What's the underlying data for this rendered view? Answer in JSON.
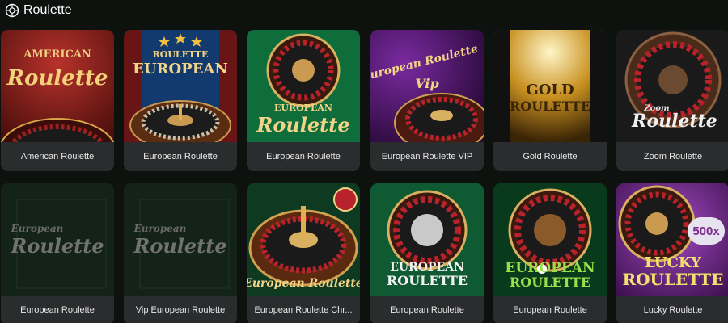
{
  "header": {
    "title": "Roulette",
    "icon": "roulette-icon"
  },
  "games": [
    {
      "label": "American Roulette",
      "art_lines": [
        "AMERICAN",
        "Roulette"
      ]
    },
    {
      "label": "European Roulette",
      "art_lines": [
        "ROULETTE",
        "EUROPEAN"
      ]
    },
    {
      "label": "European Roulette",
      "art_lines": [
        "EUROPEAN",
        "Roulette"
      ]
    },
    {
      "label": "European Roulette VIP",
      "art_lines": [
        "European Roulette",
        "Vip"
      ]
    },
    {
      "label": "Gold Roulette",
      "art_lines": [
        "GOLD",
        "ROULETTE"
      ]
    },
    {
      "label": "Zoom Roulette",
      "art_lines": [
        "Zoom",
        "Roulette"
      ]
    },
    {
      "label": "European Roulette",
      "art_lines": [
        "European",
        "Roulette"
      ]
    },
    {
      "label": "Vip European Roulette",
      "art_lines": [
        "European",
        "Roulette"
      ]
    },
    {
      "label": "European Roulette Chr...",
      "art_lines": [
        "European Roulette"
      ]
    },
    {
      "label": "European Roulette",
      "art_lines": [
        "EUROPEAN",
        "ROULETTE"
      ]
    },
    {
      "label": "European Roulette",
      "art_lines": [
        "EUROPEAN",
        "ROULETTE"
      ]
    },
    {
      "label": "Lucky Roulette",
      "art_lines": [
        "LUCKY",
        "ROULETTE"
      ],
      "badge": "500x"
    }
  ],
  "colors": {
    "background": "#0d120f",
    "card_label_bg": "#2a2c2e",
    "gold": "#e8c15a"
  }
}
